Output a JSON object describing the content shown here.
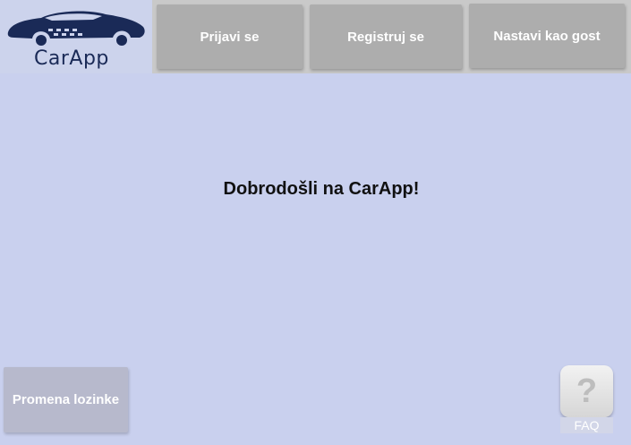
{
  "header": {
    "logo_text": "CarApp",
    "nav": {
      "login_label": "Prijavi se",
      "register_label": "Registruj se",
      "guest_label": "Nastavi kao gost"
    }
  },
  "main": {
    "welcome_text": "Dobrodošli na CarApp!"
  },
  "footer": {
    "change_password_label": "Promena lozinke",
    "faq_label": "FAQ",
    "faq_icon": "question-mark-icon"
  },
  "colors": {
    "background": "#c9d0ee",
    "topbar": "#c9c9c9",
    "nav_button": "#adadad",
    "logo_brand": "#1a2a57"
  }
}
